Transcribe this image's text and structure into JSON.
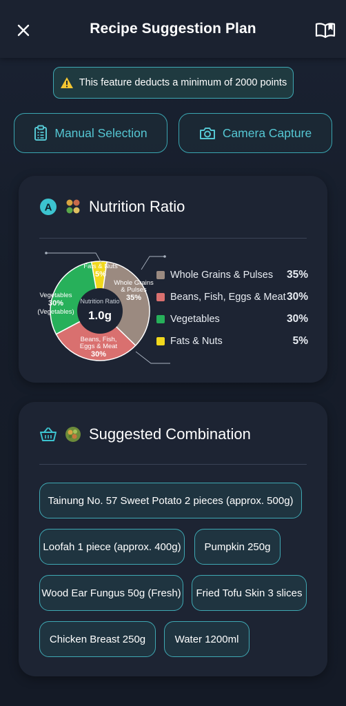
{
  "header": {
    "title": "Recipe Suggestion Plan",
    "close_icon": "close-icon",
    "guide_icon": "book-open-icon"
  },
  "warning": {
    "text": "This feature deducts a minimum of 2000 points",
    "icon": "warning-triangle-icon"
  },
  "mode_buttons": [
    {
      "label": "Manual Selection",
      "icon": "clipboard-icon"
    },
    {
      "label": "Camera Capture",
      "icon": "camera-icon"
    }
  ],
  "nutrition": {
    "title": "Nutrition Ratio",
    "badge": "A",
    "chart_data": {
      "type": "pie",
      "center_label": "Nutrition Ratio",
      "center_value": "1.0g",
      "series": [
        {
          "name": "Whole Grains & Pulses",
          "value": 35,
          "percent_label": "35%",
          "color": "#9b8a80",
          "slice_label": [
            "Whole Grains",
            "& Pulses"
          ],
          "slice_pct": "35%"
        },
        {
          "name": "Beans, Fish, Eggs & Meat",
          "value": 30,
          "percent_label": "30%",
          "color": "#d9706f",
          "slice_label": [
            "Beans, Fish,",
            "Eggs & Meat"
          ],
          "slice_pct": "30%"
        },
        {
          "name": "Vegetables",
          "value": 30,
          "percent_label": "30%",
          "color": "#27b05a",
          "slice_label": [
            "Vegetables"
          ],
          "slice_pct": "30%",
          "slice_extra": "(Vegetables)"
        },
        {
          "name": "Fats & Nuts",
          "value": 5,
          "percent_label": "5%",
          "color": "#f1d81d",
          "slice_label": [
            "Fats & Nuts"
          ],
          "slice_pct": "5%"
        }
      ]
    }
  },
  "suggested": {
    "title": "Suggested Combination",
    "items": [
      "Tainung No. 57 Sweet Potato 2 pieces (approx. 500g)",
      "Loofah 1 piece (approx. 400g)",
      "Pumpkin 250g",
      "Wood Ear Fungus 50g (Fresh)",
      "Fried Tofu Skin 3 slices",
      "Chicken Breast 250g",
      "Water 1200ml"
    ]
  }
}
